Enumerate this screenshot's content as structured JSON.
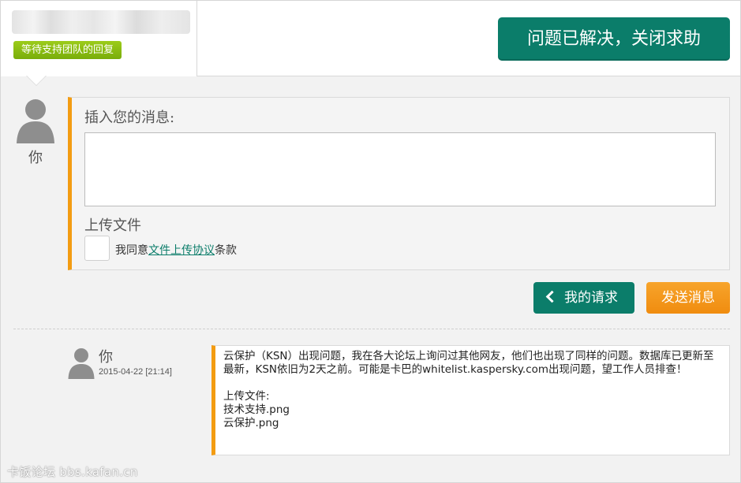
{
  "header": {
    "ticket_title_blurred": "",
    "status_badge": "等待支持团队的回复",
    "close_button": "问题已解决，关闭求助"
  },
  "composer": {
    "author": "你",
    "label": "插入您的消息:",
    "textarea_value": "",
    "upload_label": "上传文件",
    "agree_prefix": "我同意",
    "agree_link": "文件上传协议",
    "agree_suffix": "条款"
  },
  "actions": {
    "my_requests": "我的请求",
    "send": "发送消息"
  },
  "history": [
    {
      "author": "你",
      "timestamp": "2015-04-22 [21:14]",
      "message_line1": "云保护（KSN）出现问题，我在各大论坛上询问过其他网友，他们也出现了同样的问题。数据库已更新至最新，KSN依旧为2天之前。可能是卡巴的whitelist.kaspersky.com出现问题，望工作人员排查！",
      "uploads_label": "上传文件:",
      "files": [
        "技术支持.png",
        "云保护.png"
      ]
    }
  ],
  "watermark": "卡饭论坛 bbs.kafan.cn",
  "colors": {
    "teal": "#0b7d6a",
    "orange": "#f39c12",
    "badge_green": "#8cbf12"
  }
}
